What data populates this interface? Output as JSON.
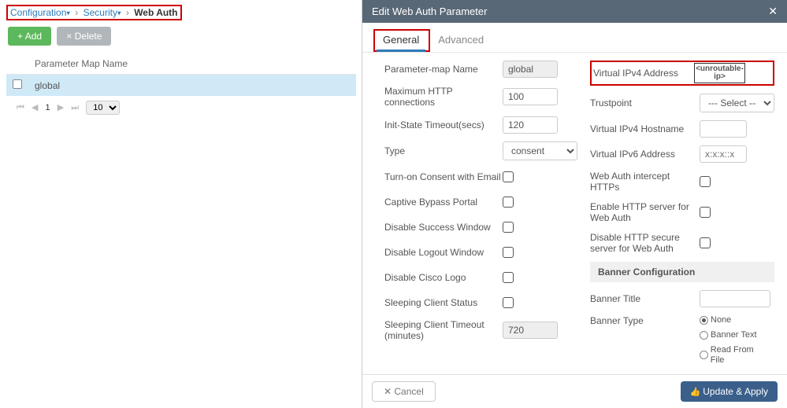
{
  "breadcrumb": {
    "l1": "Configuration",
    "l2": "Security",
    "l3": "Web Auth"
  },
  "actions": {
    "add": "Add",
    "delete": "Delete"
  },
  "table": {
    "header": "Parameter Map Name",
    "rows": [
      {
        "name": "global"
      }
    ]
  },
  "pager": {
    "page": "1",
    "size": "10"
  },
  "panel": {
    "title": "Edit Web Auth Parameter",
    "tabs": {
      "general": "General",
      "advanced": "Advanced"
    },
    "footer": {
      "cancel": "Cancel",
      "apply": "Update & Apply"
    }
  },
  "left": {
    "param_name_l": "Parameter-map Name",
    "param_name_v": "global",
    "max_http_l": "Maximum HTTP connections",
    "max_http_v": "100",
    "init_to_l": "Init-State Timeout(secs)",
    "init_to_v": "120",
    "type_l": "Type",
    "type_v": "consent",
    "consent_email_l": "Turn-on Consent with Email",
    "captive_l": "Captive Bypass Portal",
    "disable_success_l": "Disable Success Window",
    "disable_logout_l": "Disable Logout Window",
    "disable_logo_l": "Disable Cisco Logo",
    "sleep_status_l": "Sleeping Client Status",
    "sleep_to_l": "Sleeping Client Timeout (minutes)",
    "sleep_to_v": "720"
  },
  "right": {
    "vip4_l": "Virtual IPv4 Address",
    "vip4_v": "<unroutable-ip>",
    "trust_l": "Trustpoint",
    "trust_v": "--- Select ---",
    "host4_l": "Virtual IPv4 Hostname",
    "host4_v": "",
    "vip6_l": "Virtual IPv6 Address",
    "vip6_v": "x:x:x::x",
    "intercept_l": "Web Auth intercept HTTPs",
    "enable_http_l": "Enable HTTP server for Web Auth",
    "disable_https_l": "Disable HTTP secure server for Web Auth",
    "banner_section": "Banner Configuration",
    "banner_title_l": "Banner Title",
    "banner_title_v": "",
    "banner_type_l": "Banner Type",
    "banner_opts": {
      "none": "None",
      "text": "Banner Text",
      "file": "Read From File"
    }
  }
}
